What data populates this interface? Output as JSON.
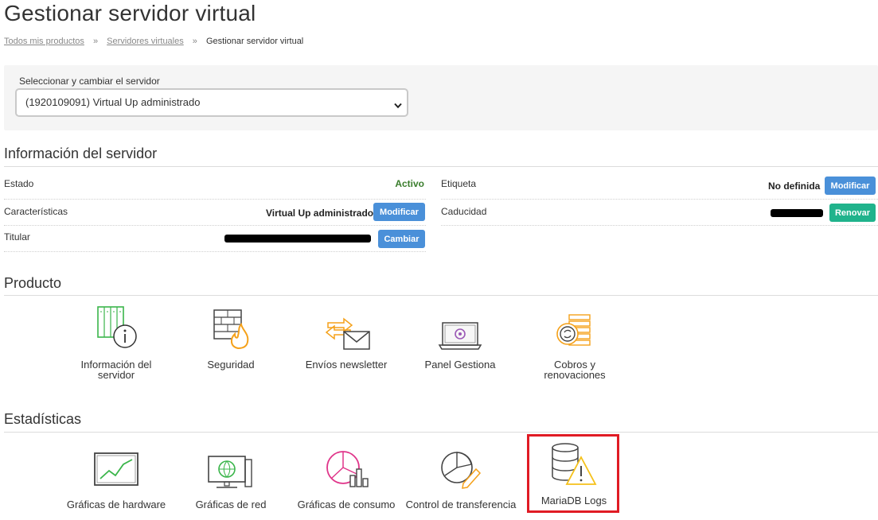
{
  "page": {
    "title": "Gestionar servidor virtual",
    "breadcrumb": [
      "Todos mis productos",
      "Servidores virtuales",
      "Gestionar servidor virtual"
    ],
    "breadcrumb_separator": "»"
  },
  "selector": {
    "label": "Seleccionar y cambiar el servidor",
    "selected": "(1920109091) Virtual Up administrado"
  },
  "server_info": {
    "title": "Información del servidor",
    "estado_label": "Estado",
    "estado_value": "Activo",
    "caracteristicas_label": "Características",
    "caracteristicas_value": "Virtual Up administrado",
    "caracteristicas_button": "Modificar",
    "titular_label": "Titular",
    "titular_button": "Cambiar",
    "etiqueta_label": "Etiqueta",
    "etiqueta_value": "No definida",
    "etiqueta_button": "Modificar",
    "caducidad_label": "Caducidad",
    "caducidad_button": "Renovar"
  },
  "producto": {
    "title": "Producto",
    "items": [
      {
        "label": "Información del servidor",
        "icon": "server-info-icon"
      },
      {
        "label": "Seguridad",
        "icon": "firewall-icon"
      },
      {
        "label": "Envíos newsletter",
        "icon": "newsletter-icon"
      },
      {
        "label": "Panel Gestiona",
        "icon": "laptop-panel-icon"
      },
      {
        "label": "Cobros y renovaciones",
        "icon": "billing-icon"
      }
    ]
  },
  "estadisticas": {
    "title": "Estadísticas",
    "items": [
      {
        "label": "Gráficas de hardware",
        "icon": "hardware-chart-icon"
      },
      {
        "label": "Gráficas de red",
        "icon": "network-chart-icon"
      },
      {
        "label": "Gráficas de consumo",
        "icon": "consumption-chart-icon"
      },
      {
        "label": "Control de transferencia",
        "icon": "transfer-control-icon"
      },
      {
        "label": "MariaDB Logs",
        "icon": "database-warning-icon"
      }
    ]
  },
  "colors": {
    "primary_button": "#4a90d9",
    "renew_button": "#20b38c",
    "active_status": "#3a7d2c",
    "highlight": "#e01b24"
  }
}
